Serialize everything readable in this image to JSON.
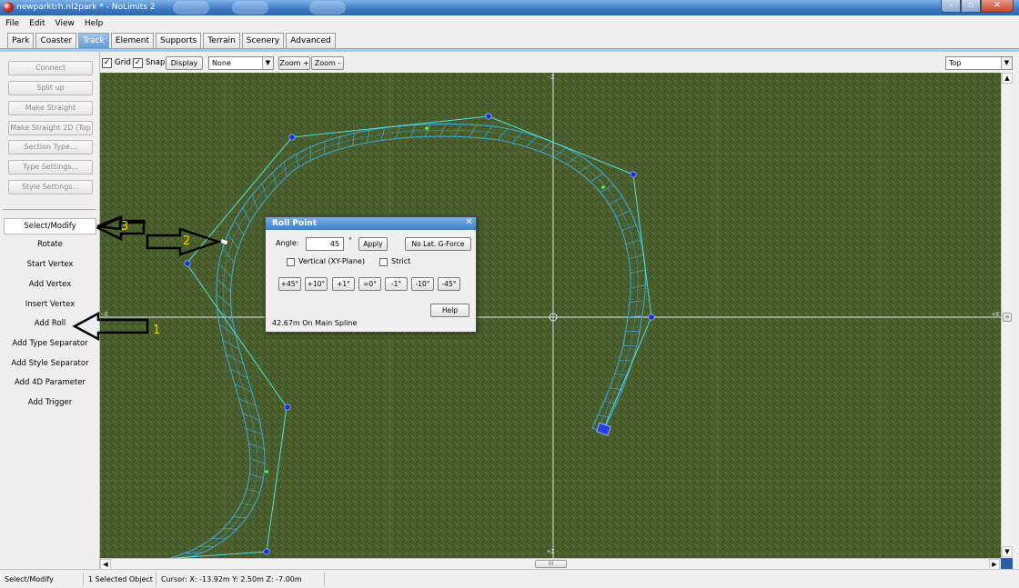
{
  "window": {
    "title": "newparktrh.nl2park * - NoLimits 2"
  },
  "menu": [
    "File",
    "Edit",
    "View",
    "Help"
  ],
  "tabs": [
    {
      "label": "Park",
      "active": false
    },
    {
      "label": "Coaster",
      "active": false
    },
    {
      "label": "Track",
      "active": true
    },
    {
      "label": "Element",
      "active": false
    },
    {
      "label": "Supports",
      "active": false
    },
    {
      "label": "Terrain",
      "active": false
    },
    {
      "label": "Scenery",
      "active": false
    },
    {
      "label": "Advanced",
      "active": false
    }
  ],
  "left_buttons": [
    "Connect",
    "Split up",
    "Make Straight",
    "Make Straight 2D (Top",
    "Section Type...",
    "Type Settings...",
    "Style Settings..."
  ],
  "tools": [
    "Select/Modify",
    "Rotate",
    "Start Vertex",
    "Add Vertex",
    "Insert Vertex",
    "Add Roll",
    "Add Type Separator",
    "Add Style Separator",
    "Add 4D Parameter",
    "Add Trigger"
  ],
  "selected_tool": "Select/Modify",
  "toolbar": {
    "grid_label": "Grid",
    "grid_checked": true,
    "snap_label": "Snap",
    "snap_checked": true,
    "display_label": "Display",
    "display_combo": "None",
    "zoom_in": "Zoom +",
    "zoom_out": "Zoom -",
    "view_combo": "Top"
  },
  "viewport": {
    "axis_labels": {
      "top": "-Z",
      "bottom": "+Z",
      "left": "-X",
      "right": "+X",
      "origin": "0"
    }
  },
  "roll_dialog": {
    "title": "Roll Point",
    "angle_label": "Angle:",
    "angle_value": "45",
    "degree_symbol": "°",
    "apply_label": "Apply",
    "no_lat_label": "No Lat. G-Force",
    "vertical_label": "Vertical (XY-Plane)",
    "strict_label": "Strict",
    "step_buttons": [
      "+45°",
      "+10°",
      "+1°",
      "=0°",
      "-1°",
      "-10°",
      "-45°"
    ],
    "help_label": "Help",
    "position_text": "42.67m On Main Spline"
  },
  "annotations": [
    "1",
    "2",
    "3"
  ],
  "statusbar": {
    "mode": "Select/Modify",
    "selection": "1 Selected Object",
    "cursor": "Cursor: X: -13.92m Y: 2.50m Z: -7.00m"
  },
  "colors": {
    "track": "#3aa8d8",
    "control_line": "#4ee0e0",
    "vertex": "#1a2fd8",
    "grass": "#4a5c2b",
    "annotation": "#f1d400"
  }
}
